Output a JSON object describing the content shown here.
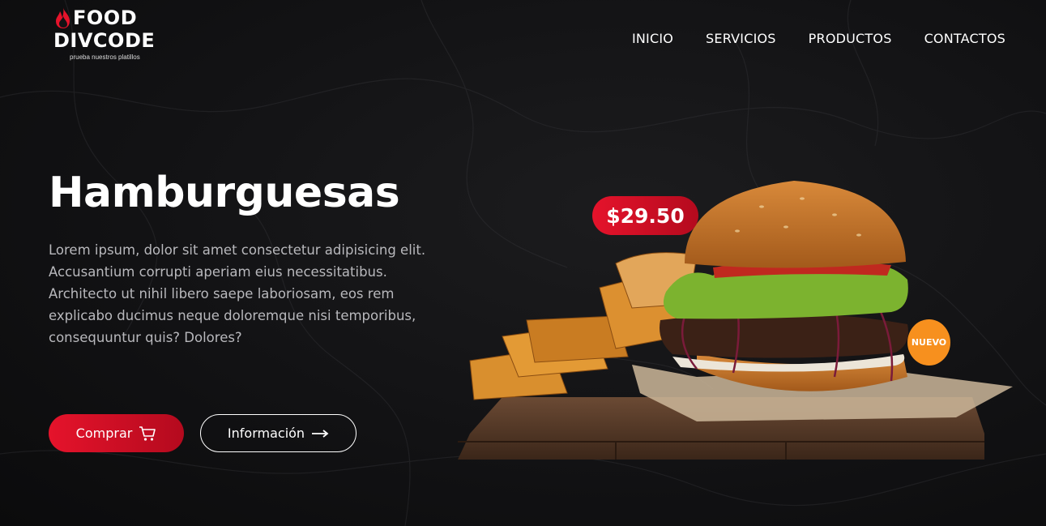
{
  "brand": {
    "line1": "FOOD",
    "line2": "DIVCODE",
    "tagline": "prueba nuestros platillos",
    "accent": "#e5132b"
  },
  "nav": {
    "items": [
      {
        "label": "INICIO"
      },
      {
        "label": "SERVICIOS"
      },
      {
        "label": "PRODUCTOS"
      },
      {
        "label": "CONTACTOS"
      }
    ]
  },
  "hero": {
    "title": "Hamburguesas",
    "description": "Lorem ipsum, dolor sit amet consectetur adipisicing elit. Accusantium corrupti aperiam eius necessitatibus. Architecto ut nihil libero saepe laboriosam, eos rem explicabo ducimus neque doloremque nisi temporibus, consequuntur quis? Dolores?",
    "buy_label": "Comprar",
    "buy_icon": "cart-icon",
    "info_label": "Información",
    "info_icon": "arrow-right-icon"
  },
  "product": {
    "price": "$29.50",
    "badge": "NUEVO",
    "image": "burger-with-fries-on-board",
    "price_color": "#e5132b",
    "badge_color": "#f7901e"
  }
}
